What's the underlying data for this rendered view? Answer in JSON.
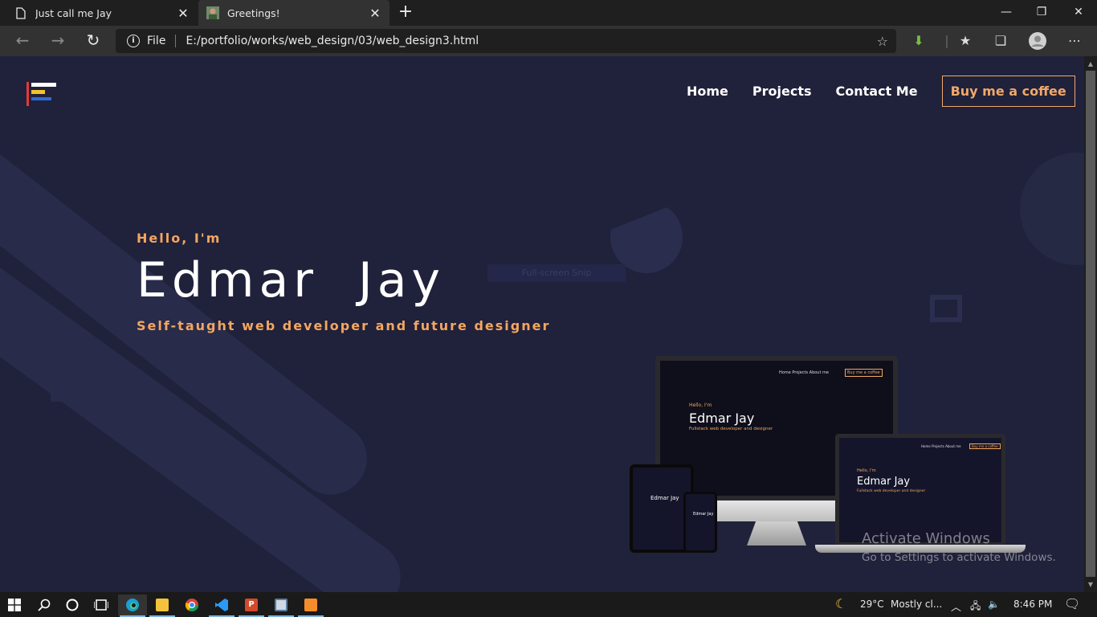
{
  "browser": {
    "tabs": [
      {
        "title": "Just call me Jay",
        "icon": "page-icon",
        "active": false
      },
      {
        "title": "Greetings!",
        "icon": "favicon-photo",
        "active": true
      }
    ],
    "new_tab": "+",
    "window_controls": {
      "minimize": "—",
      "restore": "❐",
      "close": "✕"
    },
    "nav": {
      "back": "←",
      "forward": "→",
      "refresh": "↻"
    },
    "address": {
      "scheme": "File",
      "url": "E:/portfolio/works/web_design/03/web_design3.html"
    }
  },
  "page": {
    "nav_links": [
      "Home",
      "Projects",
      "Contact Me"
    ],
    "cta": "Buy me a coffee",
    "hello": "Hello, I'm",
    "name": "Edmar  Jay",
    "tagline": "Self-taught web developer and future designer",
    "ghost_button": "Full-screen Snip",
    "mockup": {
      "nav": "Home   Projects   About me",
      "cta": "Buy me a coffee",
      "hello": "Hello, I'm",
      "name": "Edmar Jay",
      "sub": "Fullstack web developer and designer"
    },
    "colors": {
      "background": "#20213a",
      "accent": "#f4a660",
      "text": "#ffffff"
    }
  },
  "watermark": {
    "line1": "Activate Windows",
    "line2": "Go to Settings to activate Windows."
  },
  "taskbar": {
    "weather_temp": "29°C",
    "weather_desc": "Mostly cl...",
    "time": "8:46 PM"
  }
}
